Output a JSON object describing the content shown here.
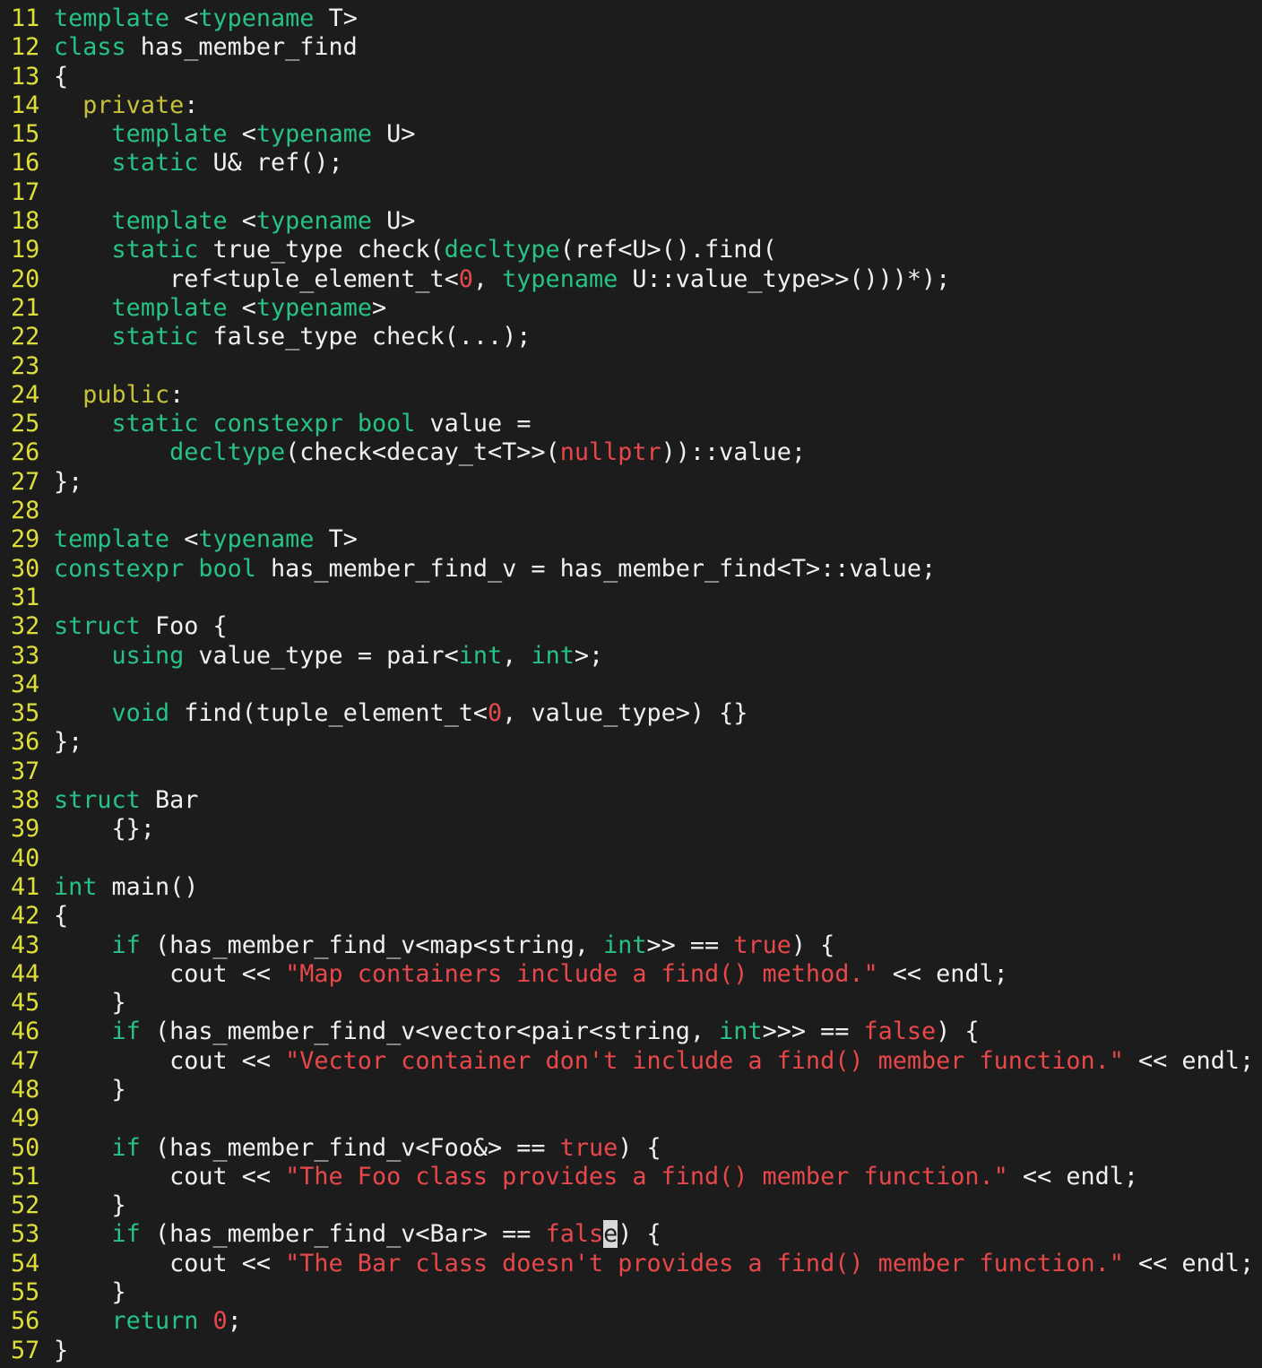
{
  "editor": {
    "colors": {
      "background": "#1c1c1c",
      "line_number": "#dede3a",
      "keyword": "#27c285",
      "access_specifier": "#c8c238",
      "literal": "#e8484a",
      "plain": "#f0f0f0"
    },
    "cursor": {
      "line": 53,
      "char": "e"
    },
    "lines": [
      {
        "n": "11",
        "tokens": [
          [
            "kw",
            "template"
          ],
          [
            "pl",
            " <"
          ],
          [
            "kw",
            "typename"
          ],
          [
            "pl",
            " T>"
          ]
        ]
      },
      {
        "n": "12",
        "tokens": [
          [
            "kw",
            "class"
          ],
          [
            "pl",
            " has_member_find"
          ]
        ]
      },
      {
        "n": "13",
        "tokens": [
          [
            "pl",
            "{"
          ]
        ]
      },
      {
        "n": "14",
        "tokens": [
          [
            "pl",
            "  "
          ],
          [
            "acc",
            "private"
          ],
          [
            "pl",
            ":"
          ]
        ]
      },
      {
        "n": "15",
        "tokens": [
          [
            "pl",
            "    "
          ],
          [
            "kw",
            "template"
          ],
          [
            "pl",
            " <"
          ],
          [
            "kw",
            "typename"
          ],
          [
            "pl",
            " U>"
          ]
        ]
      },
      {
        "n": "16",
        "tokens": [
          [
            "pl",
            "    "
          ],
          [
            "kw",
            "static"
          ],
          [
            "pl",
            " U& ref();"
          ]
        ]
      },
      {
        "n": "17",
        "tokens": []
      },
      {
        "n": "18",
        "tokens": [
          [
            "pl",
            "    "
          ],
          [
            "kw",
            "template"
          ],
          [
            "pl",
            " <"
          ],
          [
            "kw",
            "typename"
          ],
          [
            "pl",
            " U>"
          ]
        ]
      },
      {
        "n": "19",
        "tokens": [
          [
            "pl",
            "    "
          ],
          [
            "kw",
            "static"
          ],
          [
            "pl",
            " true_type check("
          ],
          [
            "kw",
            "decltype"
          ],
          [
            "pl",
            "(ref<U>().find("
          ]
        ]
      },
      {
        "n": "20",
        "tokens": [
          [
            "pl",
            "        ref<tuple_element_t<"
          ],
          [
            "num",
            "0"
          ],
          [
            "pl",
            ", "
          ],
          [
            "kw",
            "typename"
          ],
          [
            "pl",
            " U::value_type>>()))*);"
          ]
        ]
      },
      {
        "n": "21",
        "tokens": [
          [
            "pl",
            "    "
          ],
          [
            "kw",
            "template"
          ],
          [
            "pl",
            " <"
          ],
          [
            "kw",
            "typename"
          ],
          [
            "pl",
            ">"
          ]
        ]
      },
      {
        "n": "22",
        "tokens": [
          [
            "pl",
            "    "
          ],
          [
            "kw",
            "static"
          ],
          [
            "pl",
            " false_type check(...);"
          ]
        ]
      },
      {
        "n": "23",
        "tokens": []
      },
      {
        "n": "24",
        "tokens": [
          [
            "pl",
            "  "
          ],
          [
            "acc",
            "public"
          ],
          [
            "pl",
            ":"
          ]
        ]
      },
      {
        "n": "25",
        "tokens": [
          [
            "pl",
            "    "
          ],
          [
            "kw",
            "static"
          ],
          [
            "pl",
            " "
          ],
          [
            "kw",
            "constexpr"
          ],
          [
            "pl",
            " "
          ],
          [
            "kw",
            "bool"
          ],
          [
            "pl",
            " value ="
          ]
        ]
      },
      {
        "n": "26",
        "tokens": [
          [
            "pl",
            "        "
          ],
          [
            "kw",
            "decltype"
          ],
          [
            "pl",
            "(check<decay_t<T>>("
          ],
          [
            "lit",
            "nullptr"
          ],
          [
            "pl",
            "))::value;"
          ]
        ]
      },
      {
        "n": "27",
        "tokens": [
          [
            "pl",
            "};"
          ]
        ]
      },
      {
        "n": "28",
        "tokens": []
      },
      {
        "n": "29",
        "tokens": [
          [
            "kw",
            "template"
          ],
          [
            "pl",
            " <"
          ],
          [
            "kw",
            "typename"
          ],
          [
            "pl",
            " T>"
          ]
        ]
      },
      {
        "n": "30",
        "tokens": [
          [
            "kw",
            "constexpr"
          ],
          [
            "pl",
            " "
          ],
          [
            "kw",
            "bool"
          ],
          [
            "pl",
            " has_member_find_v = has_member_find<T>::value;"
          ]
        ]
      },
      {
        "n": "31",
        "tokens": []
      },
      {
        "n": "32",
        "tokens": [
          [
            "kw",
            "struct"
          ],
          [
            "pl",
            " Foo {"
          ]
        ]
      },
      {
        "n": "33",
        "tokens": [
          [
            "pl",
            "    "
          ],
          [
            "kw",
            "using"
          ],
          [
            "pl",
            " value_type = pair<"
          ],
          [
            "kw",
            "int"
          ],
          [
            "pl",
            ", "
          ],
          [
            "kw",
            "int"
          ],
          [
            "pl",
            ">;"
          ]
        ]
      },
      {
        "n": "34",
        "tokens": []
      },
      {
        "n": "35",
        "tokens": [
          [
            "pl",
            "    "
          ],
          [
            "kw",
            "void"
          ],
          [
            "pl",
            " find(tuple_element_t<"
          ],
          [
            "num",
            "0"
          ],
          [
            "pl",
            ", value_type>) {}"
          ]
        ]
      },
      {
        "n": "36",
        "tokens": [
          [
            "pl",
            "};"
          ]
        ]
      },
      {
        "n": "37",
        "tokens": []
      },
      {
        "n": "38",
        "tokens": [
          [
            "kw",
            "struct"
          ],
          [
            "pl",
            " Bar"
          ]
        ]
      },
      {
        "n": "39",
        "tokens": [
          [
            "pl",
            "    {};"
          ]
        ]
      },
      {
        "n": "40",
        "tokens": []
      },
      {
        "n": "41",
        "tokens": [
          [
            "kw",
            "int"
          ],
          [
            "pl",
            " main()"
          ]
        ]
      },
      {
        "n": "42",
        "tokens": [
          [
            "pl",
            "{"
          ]
        ]
      },
      {
        "n": "43",
        "tokens": [
          [
            "pl",
            "    "
          ],
          [
            "kw",
            "if"
          ],
          [
            "pl",
            " (has_member_find_v<map<string, "
          ],
          [
            "kw",
            "int"
          ],
          [
            "pl",
            ">> == "
          ],
          [
            "lit",
            "true"
          ],
          [
            "pl",
            ") {"
          ]
        ]
      },
      {
        "n": "44",
        "tokens": [
          [
            "pl",
            "        cout << "
          ],
          [
            "str",
            "\"Map containers include a find() method.\""
          ],
          [
            "pl",
            " << endl;"
          ]
        ]
      },
      {
        "n": "45",
        "tokens": [
          [
            "pl",
            "    }"
          ]
        ]
      },
      {
        "n": "46",
        "tokens": [
          [
            "pl",
            "    "
          ],
          [
            "kw",
            "if"
          ],
          [
            "pl",
            " (has_member_find_v<vector<pair<string, "
          ],
          [
            "kw",
            "int"
          ],
          [
            "pl",
            ">>> == "
          ],
          [
            "lit",
            "false"
          ],
          [
            "pl",
            ") {"
          ]
        ]
      },
      {
        "n": "47",
        "tokens": [
          [
            "pl",
            "        cout << "
          ],
          [
            "str",
            "\"Vector container don't include a find() member function.\""
          ],
          [
            "pl",
            " << endl;"
          ]
        ]
      },
      {
        "n": "48",
        "tokens": [
          [
            "pl",
            "    }"
          ]
        ]
      },
      {
        "n": "49",
        "tokens": []
      },
      {
        "n": "50",
        "tokens": [
          [
            "pl",
            "    "
          ],
          [
            "kw",
            "if"
          ],
          [
            "pl",
            " (has_member_find_v<Foo&> == "
          ],
          [
            "lit",
            "true"
          ],
          [
            "pl",
            ") {"
          ]
        ]
      },
      {
        "n": "51",
        "tokens": [
          [
            "pl",
            "        cout << "
          ],
          [
            "str",
            "\"The Foo class provides a find() member function.\""
          ],
          [
            "pl",
            " << endl;"
          ]
        ]
      },
      {
        "n": "52",
        "tokens": [
          [
            "pl",
            "    }"
          ]
        ]
      },
      {
        "n": "53",
        "tokens": [
          [
            "pl",
            "    "
          ],
          [
            "kw",
            "if"
          ],
          [
            "pl",
            " (has_member_find_v<Bar> == "
          ],
          [
            "lit",
            "fals"
          ],
          [
            "cursor",
            "e"
          ],
          [
            "pl",
            ") {"
          ]
        ]
      },
      {
        "n": "54",
        "tokens": [
          [
            "pl",
            "        cout << "
          ],
          [
            "str",
            "\"The Bar class doesn't provides a find() member function.\""
          ],
          [
            "pl",
            " << endl;"
          ]
        ]
      },
      {
        "n": "55",
        "tokens": [
          [
            "pl",
            "    }"
          ]
        ]
      },
      {
        "n": "56",
        "tokens": [
          [
            "pl",
            "    "
          ],
          [
            "kw",
            "return"
          ],
          [
            "pl",
            " "
          ],
          [
            "num",
            "0"
          ],
          [
            "pl",
            ";"
          ]
        ]
      },
      {
        "n": "57",
        "tokens": [
          [
            "pl",
            "}"
          ]
        ]
      }
    ]
  }
}
